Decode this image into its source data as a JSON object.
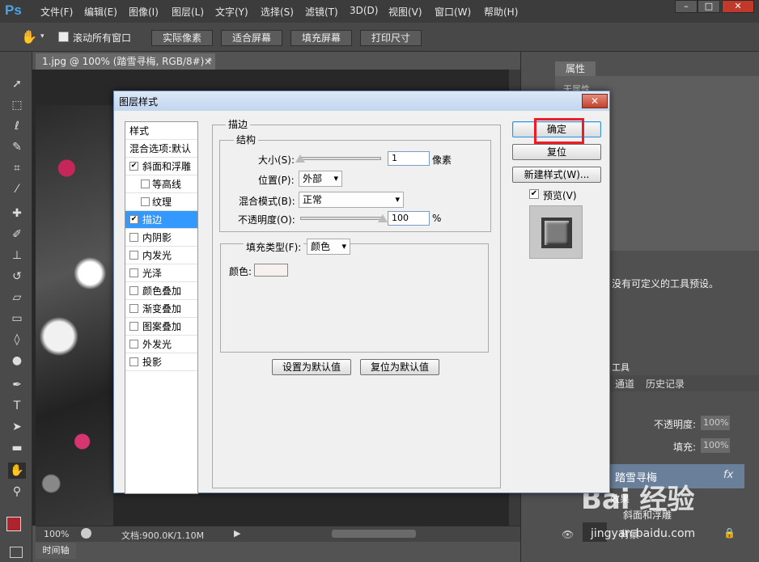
{
  "app": {
    "logo": "Ps",
    "menu": [
      "文件(F)",
      "编辑(E)",
      "图像(I)",
      "图层(L)",
      "文字(Y)",
      "选择(S)",
      "滤镜(T)",
      "3D(D)",
      "视图(V)",
      "窗口(W)",
      "帮助(H)"
    ],
    "window_controls": {
      "minimize": "–",
      "maximize": "□",
      "close": "✕"
    }
  },
  "options_bar": {
    "scroll_all_windows": "滚动所有窗口",
    "buttons": [
      "实际像素",
      "适合屏幕",
      "填充屏幕",
      "打印尺寸"
    ]
  },
  "document": {
    "tab_title": "1.jpg @ 100% (踏雪寻梅, RGB/8#) *",
    "tab_close": "×",
    "zoom": "100%",
    "doc_size": "文档:900.0K/1.10M",
    "timeline_tab": "时间轴"
  },
  "panels": {
    "properties_tab": "属性",
    "properties_sub": "无属性",
    "preset_message": "没有可定义的工具预设。",
    "layers_tabs": [
      "通道",
      "历史记录"
    ],
    "opacity_label": "不透明度:",
    "opacity_value": "100%",
    "fill_label": "填充:",
    "fill_value": "100%",
    "layer_name": "踏雪寻梅",
    "layer_fx": "fx",
    "effects_label": "效果",
    "bevel_label": "斜面和浮雕",
    "bg_layer": "背景",
    "tools_label": "工具"
  },
  "dialog": {
    "title": "图层样式",
    "close": "✕",
    "styles_header": "样式",
    "blend_options": "混合选项:默认",
    "style_items": [
      {
        "label": "斜面和浮雕",
        "checked": true,
        "indent": false
      },
      {
        "label": "等高线",
        "checked": false,
        "indent": true
      },
      {
        "label": "纹理",
        "checked": false,
        "indent": true
      },
      {
        "label": "描边",
        "checked": true,
        "indent": false,
        "selected": true
      },
      {
        "label": "内阴影",
        "checked": false,
        "indent": false
      },
      {
        "label": "内发光",
        "checked": false,
        "indent": false
      },
      {
        "label": "光泽",
        "checked": false,
        "indent": false
      },
      {
        "label": "颜色叠加",
        "checked": false,
        "indent": false
      },
      {
        "label": "渐变叠加",
        "checked": false,
        "indent": false
      },
      {
        "label": "图案叠加",
        "checked": false,
        "indent": false
      },
      {
        "label": "外发光",
        "checked": false,
        "indent": false
      },
      {
        "label": "投影",
        "checked": false,
        "indent": false
      }
    ],
    "stroke": {
      "group_title": "描边",
      "structure_title": "结构",
      "size_label": "大小(S):",
      "size_value": "1",
      "size_unit": "像素",
      "position_label": "位置(P):",
      "position_value": "外部",
      "blend_label": "混合模式(B):",
      "blend_value": "正常",
      "opacity_label": "不透明度(O):",
      "opacity_value": "100",
      "opacity_unit": "%",
      "size_fraction": 0.0,
      "opacity_fraction": 1.0,
      "fill_type_label": "填充类型(F):",
      "fill_type_value": "颜色",
      "color_label": "颜色:",
      "color_value": "#f6f0ef"
    },
    "buttons": {
      "ok": "确定",
      "reset": "复位",
      "new_style": "新建样式(W)...",
      "preview": "预览(V)",
      "set_default": "设置为默认值",
      "reset_default": "复位为默认值"
    }
  },
  "watermark": {
    "text": "Bai 经验",
    "url": "jingyan.baidu.com"
  }
}
